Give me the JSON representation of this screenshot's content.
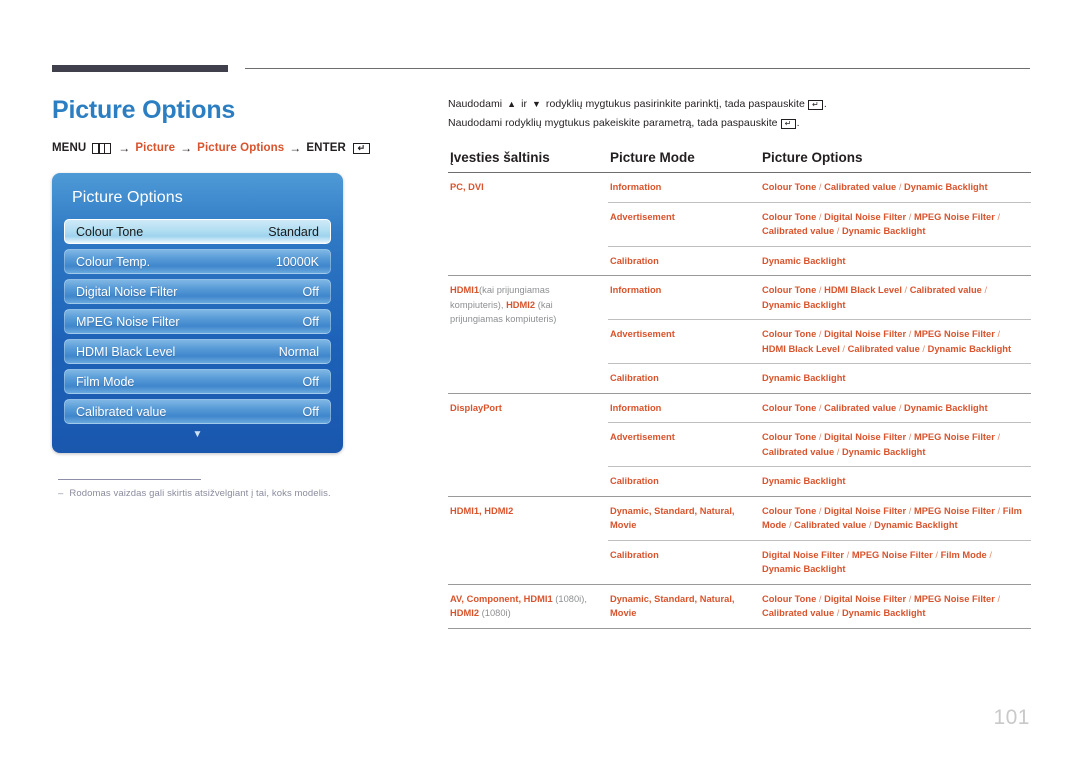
{
  "page": {
    "number": "101"
  },
  "header": {
    "title": "Picture Options",
    "breadcrumb": {
      "menu_label": "MENU",
      "menu_icon": "menu-bars-icon",
      "arrow": "→",
      "item1": "Picture",
      "item2": "Picture Options",
      "enter_label": "ENTER",
      "enter_icon": "enter-return-icon"
    }
  },
  "osd": {
    "title": "Picture Options",
    "rows": [
      {
        "label": "Colour Tone",
        "value": "Standard",
        "selected": true
      },
      {
        "label": "Colour Temp.",
        "value": "10000K",
        "selected": false
      },
      {
        "label": "Digital Noise Filter",
        "value": "Off",
        "selected": false
      },
      {
        "label": "MPEG Noise Filter",
        "value": "Off",
        "selected": false
      },
      {
        "label": "HDMI Black Level",
        "value": "Normal",
        "selected": false
      },
      {
        "label": "Film Mode",
        "value": "Off",
        "selected": false
      },
      {
        "label": "Calibrated value",
        "value": "Off",
        "selected": false
      }
    ],
    "scroll_caret": "▼"
  },
  "footnote": {
    "dash": "–",
    "text": "Rodomas vaizdas gali skirtis atsižvelgiant į tai, koks modelis."
  },
  "intro": {
    "line1_a": "Naudodami",
    "line1_up": "▲",
    "line1_b": "ir",
    "line1_down": "▼",
    "line1_c": "rodyklių mygtukus pasirinkite parinktį, tada paspauskite",
    "line1_end": ".",
    "line2_a": "Naudodami rodyklių mygtukus pakeiskite parametrą, tada paspauskite",
    "line2_end": ".",
    "enter_icon": "enter-return-icon"
  },
  "table": {
    "headers": {
      "col1": "Įvesties šaltinis",
      "col2": "Picture Mode",
      "col3": "Picture Options"
    },
    "groups": [
      {
        "source": "PC, DVI",
        "source_plain": "",
        "rows": [
          {
            "mode": "Information",
            "options": "Colour Tone / Calibrated value / Dynamic Backlight"
          },
          {
            "mode": "Advertisement",
            "options": "Colour Tone / Digital Noise Filter / MPEG Noise Filter / Calibrated value / Dynamic Backlight"
          },
          {
            "mode": "Calibration",
            "options": "Dynamic Backlight"
          }
        ]
      },
      {
        "source": "HDMI1",
        "source_note1": "(kai prijungiamas kompiuteris), ",
        "source2": "HDMI2",
        "source_note2": " (kai prijungiamas kompiuteris)",
        "rows": [
          {
            "mode": "Information",
            "options": "Colour Tone / HDMI Black Level / Calibrated value / Dynamic Backlight"
          },
          {
            "mode": "Advertisement",
            "options": "Colour Tone / Digital Noise Filter / MPEG Noise Filter / HDMI Black Level / Calibrated value / Dynamic Backlight"
          },
          {
            "mode": "Calibration",
            "options": "Dynamic Backlight"
          }
        ]
      },
      {
        "source": "DisplayPort",
        "rows": [
          {
            "mode": "Information",
            "options": "Colour Tone / Calibrated value / Dynamic Backlight"
          },
          {
            "mode": "Advertisement",
            "options": "Colour Tone / Digital Noise Filter / MPEG Noise Filter / Calibrated value / Dynamic Backlight"
          },
          {
            "mode": "Calibration",
            "options": "Dynamic Backlight"
          }
        ]
      },
      {
        "source": "HDMI1, HDMI2",
        "rows": [
          {
            "mode": "Dynamic, Standard, Natural, Movie",
            "options": "Colour Tone / Digital Noise Filter / MPEG Noise Filter / Film Mode / Calibrated value / Dynamic Backlight"
          },
          {
            "mode": "Calibration",
            "options": "Digital Noise Filter / MPEG Noise Filter / Film Mode / Dynamic Backlight"
          }
        ]
      },
      {
        "source": "AV, Component, HDMI1",
        "source_note1": " (1080i), ",
        "source2": "HDMI2",
        "source_note2": " (1080i)",
        "rows": [
          {
            "mode": "Dynamic, Standard, Natural, Movie",
            "options": "Colour Tone / Digital Noise Filter / MPEG Noise Filter / Calibrated value / Dynamic Backlight"
          }
        ]
      }
    ]
  }
}
